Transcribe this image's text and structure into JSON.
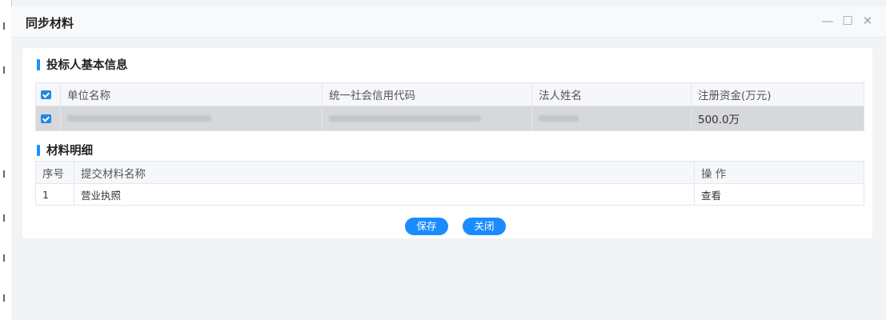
{
  "dialog": {
    "title": "同步材料",
    "controls": {
      "minimize": "—",
      "maximize": "☐",
      "close": "✕"
    }
  },
  "bidder": {
    "section_title": "投标人基本信息",
    "columns": [
      "单位名称",
      "统一社会信用代码",
      "法人姓名",
      "注册资金(万元)"
    ],
    "rows": [
      {
        "checked": true,
        "capital": "500.0万"
      }
    ]
  },
  "materials": {
    "section_title": "材料明细",
    "columns": [
      "序号",
      "提交材料名称",
      "操 作"
    ],
    "rows": [
      {
        "index": "1",
        "name": "营业执照",
        "action": "查看"
      }
    ]
  },
  "buttons": {
    "save": "保存",
    "close": "关闭"
  },
  "colors": {
    "accent": "#1a8cff",
    "checkbox": "#1e88e5",
    "selected_row": "#d6d8db"
  }
}
